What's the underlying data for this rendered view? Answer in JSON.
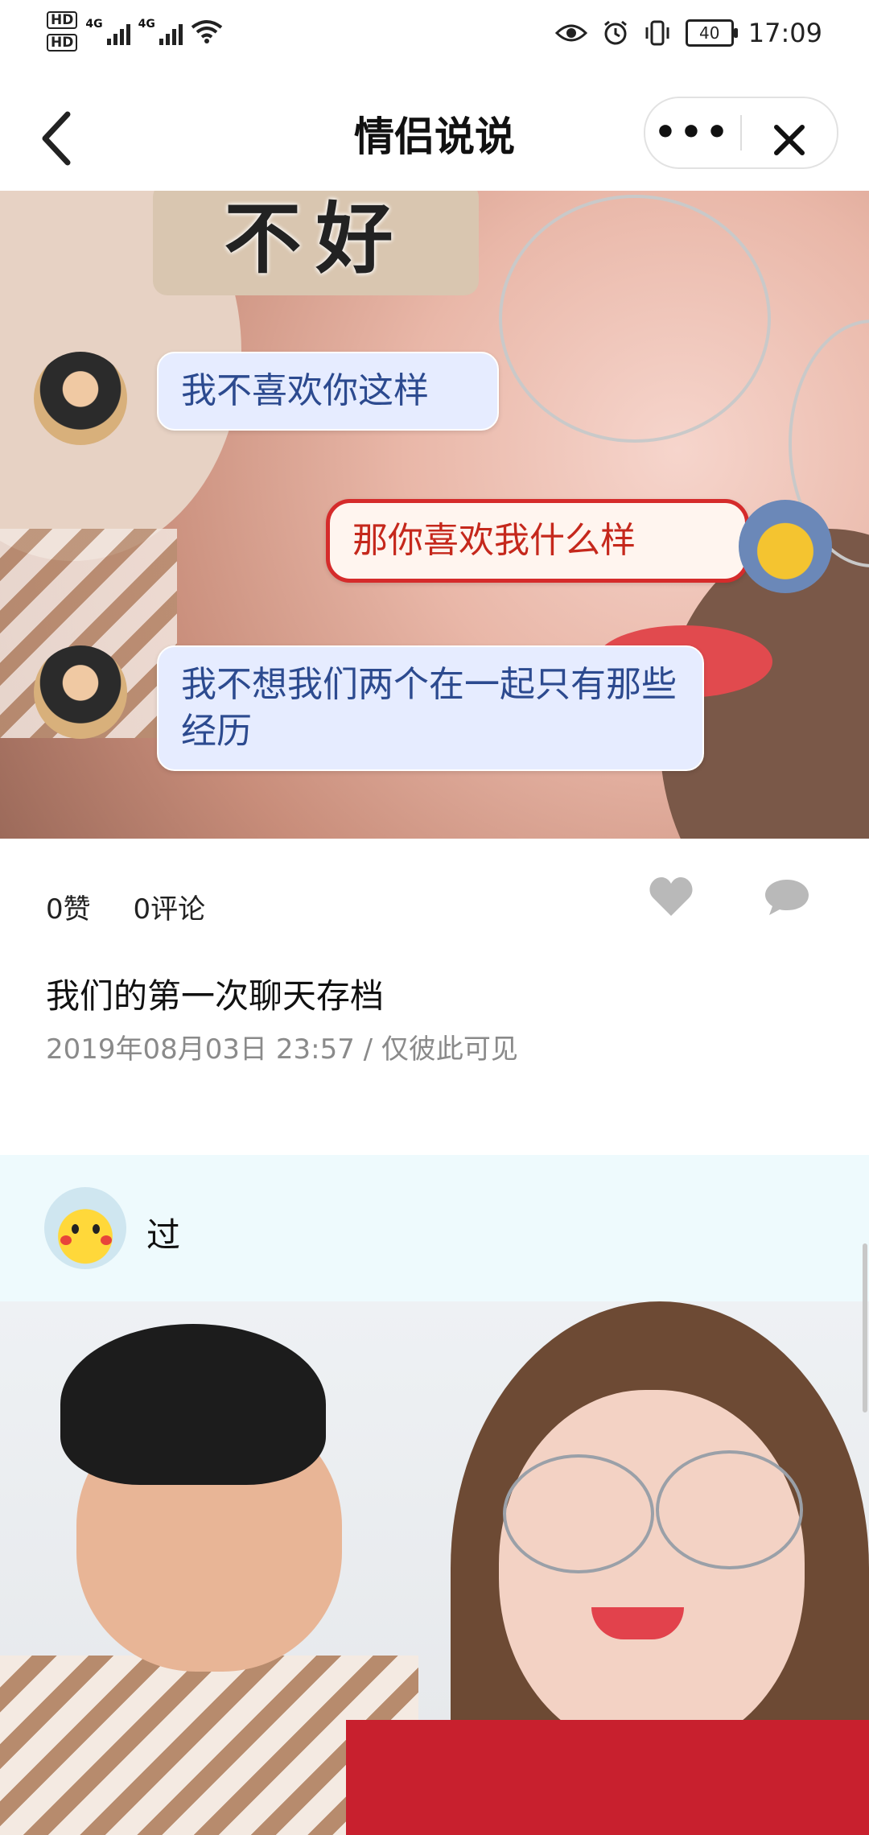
{
  "status_bar": {
    "hd1": "HD",
    "hd2": "HD",
    "net1": "4G",
    "net2": "4G",
    "battery": "40",
    "time": "17:09"
  },
  "nav": {
    "title": "情侣说说",
    "more_label": "•••"
  },
  "post1": {
    "image_chat": {
      "sticker_text": "不好",
      "bubble1": "我不喜欢你这样",
      "bubble2": "那你喜欢我什么样",
      "bubble3": "我不想我们两个在一起只有那些经历"
    },
    "likes": "0赞",
    "comments": "0评论",
    "title": "我们的第一次聊天存档",
    "meta": "2019年08月03日 23:57 / 仅彼此可见"
  },
  "post2": {
    "username": "过"
  },
  "colors": {
    "post2_header_bg": "#eefafd",
    "meta_gray": "#8a8a8a",
    "icon_gray": "#b9b9b9"
  }
}
